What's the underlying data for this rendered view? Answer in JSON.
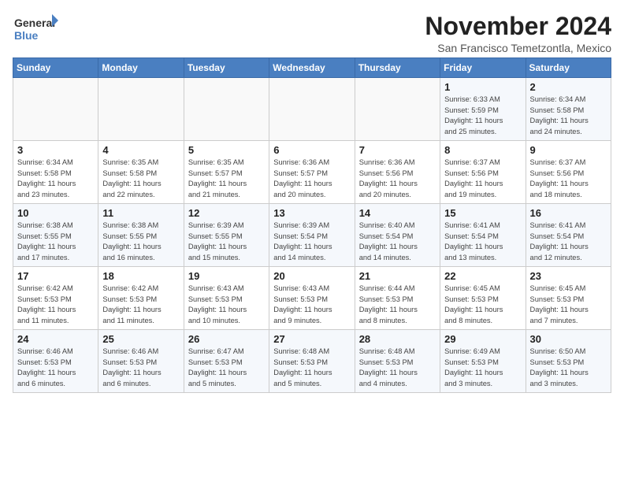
{
  "logo": {
    "line1": "General",
    "line2": "Blue"
  },
  "title": "November 2024",
  "subtitle": "San Francisco Temetzontla, Mexico",
  "days_of_week": [
    "Sunday",
    "Monday",
    "Tuesday",
    "Wednesday",
    "Thursday",
    "Friday",
    "Saturday"
  ],
  "weeks": [
    [
      {
        "day": "",
        "info": ""
      },
      {
        "day": "",
        "info": ""
      },
      {
        "day": "",
        "info": ""
      },
      {
        "day": "",
        "info": ""
      },
      {
        "day": "",
        "info": ""
      },
      {
        "day": "1",
        "info": "Sunrise: 6:33 AM\nSunset: 5:59 PM\nDaylight: 11 hours\nand 25 minutes."
      },
      {
        "day": "2",
        "info": "Sunrise: 6:34 AM\nSunset: 5:58 PM\nDaylight: 11 hours\nand 24 minutes."
      }
    ],
    [
      {
        "day": "3",
        "info": "Sunrise: 6:34 AM\nSunset: 5:58 PM\nDaylight: 11 hours\nand 23 minutes."
      },
      {
        "day": "4",
        "info": "Sunrise: 6:35 AM\nSunset: 5:58 PM\nDaylight: 11 hours\nand 22 minutes."
      },
      {
        "day": "5",
        "info": "Sunrise: 6:35 AM\nSunset: 5:57 PM\nDaylight: 11 hours\nand 21 minutes."
      },
      {
        "day": "6",
        "info": "Sunrise: 6:36 AM\nSunset: 5:57 PM\nDaylight: 11 hours\nand 20 minutes."
      },
      {
        "day": "7",
        "info": "Sunrise: 6:36 AM\nSunset: 5:56 PM\nDaylight: 11 hours\nand 20 minutes."
      },
      {
        "day": "8",
        "info": "Sunrise: 6:37 AM\nSunset: 5:56 PM\nDaylight: 11 hours\nand 19 minutes."
      },
      {
        "day": "9",
        "info": "Sunrise: 6:37 AM\nSunset: 5:56 PM\nDaylight: 11 hours\nand 18 minutes."
      }
    ],
    [
      {
        "day": "10",
        "info": "Sunrise: 6:38 AM\nSunset: 5:55 PM\nDaylight: 11 hours\nand 17 minutes."
      },
      {
        "day": "11",
        "info": "Sunrise: 6:38 AM\nSunset: 5:55 PM\nDaylight: 11 hours\nand 16 minutes."
      },
      {
        "day": "12",
        "info": "Sunrise: 6:39 AM\nSunset: 5:55 PM\nDaylight: 11 hours\nand 15 minutes."
      },
      {
        "day": "13",
        "info": "Sunrise: 6:39 AM\nSunset: 5:54 PM\nDaylight: 11 hours\nand 14 minutes."
      },
      {
        "day": "14",
        "info": "Sunrise: 6:40 AM\nSunset: 5:54 PM\nDaylight: 11 hours\nand 14 minutes."
      },
      {
        "day": "15",
        "info": "Sunrise: 6:41 AM\nSunset: 5:54 PM\nDaylight: 11 hours\nand 13 minutes."
      },
      {
        "day": "16",
        "info": "Sunrise: 6:41 AM\nSunset: 5:54 PM\nDaylight: 11 hours\nand 12 minutes."
      }
    ],
    [
      {
        "day": "17",
        "info": "Sunrise: 6:42 AM\nSunset: 5:53 PM\nDaylight: 11 hours\nand 11 minutes."
      },
      {
        "day": "18",
        "info": "Sunrise: 6:42 AM\nSunset: 5:53 PM\nDaylight: 11 hours\nand 11 minutes."
      },
      {
        "day": "19",
        "info": "Sunrise: 6:43 AM\nSunset: 5:53 PM\nDaylight: 11 hours\nand 10 minutes."
      },
      {
        "day": "20",
        "info": "Sunrise: 6:43 AM\nSunset: 5:53 PM\nDaylight: 11 hours\nand 9 minutes."
      },
      {
        "day": "21",
        "info": "Sunrise: 6:44 AM\nSunset: 5:53 PM\nDaylight: 11 hours\nand 8 minutes."
      },
      {
        "day": "22",
        "info": "Sunrise: 6:45 AM\nSunset: 5:53 PM\nDaylight: 11 hours\nand 8 minutes."
      },
      {
        "day": "23",
        "info": "Sunrise: 6:45 AM\nSunset: 5:53 PM\nDaylight: 11 hours\nand 7 minutes."
      }
    ],
    [
      {
        "day": "24",
        "info": "Sunrise: 6:46 AM\nSunset: 5:53 PM\nDaylight: 11 hours\nand 6 minutes."
      },
      {
        "day": "25",
        "info": "Sunrise: 6:46 AM\nSunset: 5:53 PM\nDaylight: 11 hours\nand 6 minutes."
      },
      {
        "day": "26",
        "info": "Sunrise: 6:47 AM\nSunset: 5:53 PM\nDaylight: 11 hours\nand 5 minutes."
      },
      {
        "day": "27",
        "info": "Sunrise: 6:48 AM\nSunset: 5:53 PM\nDaylight: 11 hours\nand 5 minutes."
      },
      {
        "day": "28",
        "info": "Sunrise: 6:48 AM\nSunset: 5:53 PM\nDaylight: 11 hours\nand 4 minutes."
      },
      {
        "day": "29",
        "info": "Sunrise: 6:49 AM\nSunset: 5:53 PM\nDaylight: 11 hours\nand 3 minutes."
      },
      {
        "day": "30",
        "info": "Sunrise: 6:50 AM\nSunset: 5:53 PM\nDaylight: 11 hours\nand 3 minutes."
      }
    ]
  ]
}
